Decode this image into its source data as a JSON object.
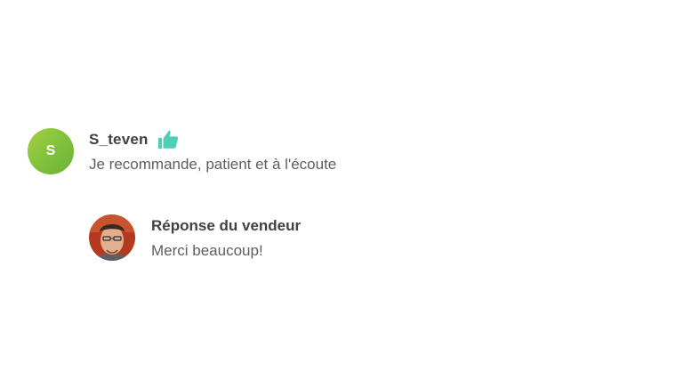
{
  "review": {
    "avatar_letter": "S",
    "username": "S_teven",
    "rating_icon": "thumbs-up-icon",
    "text": "Je recommande, patient et à l'écoute"
  },
  "reply": {
    "title": "Réponse du vendeur",
    "text": "Merci beaucoup!"
  },
  "colors": {
    "avatar_green": "#8cc63f",
    "thumb_teal": "#4fcfb6",
    "text_dark": "#404145",
    "text_body": "#5c5e66"
  }
}
